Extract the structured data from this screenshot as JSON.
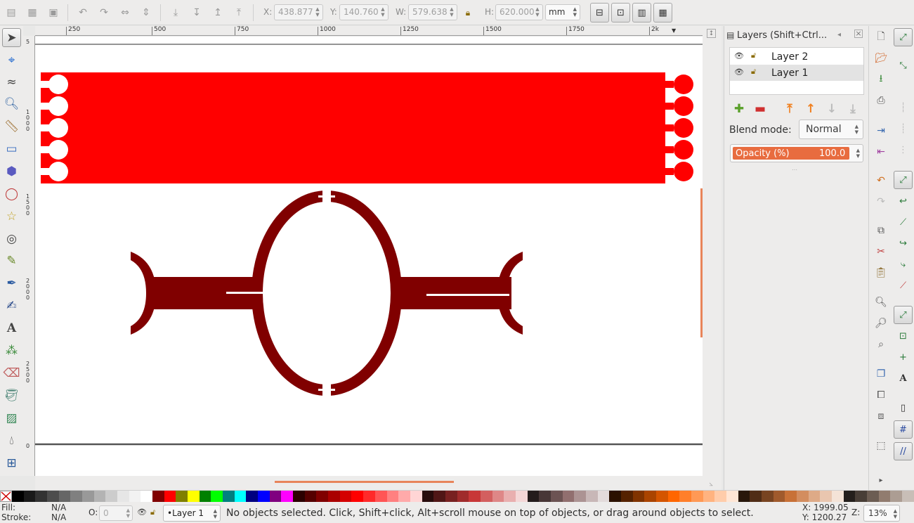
{
  "toolbar": {
    "x_label": "X:",
    "x_value": "438.877",
    "y_label": "Y:",
    "y_value": "140.760",
    "w_label": "W:",
    "w_value": "579.638",
    "h_label": "H:",
    "h_value": "620.000",
    "unit": "mm"
  },
  "ruler": {
    "top_labels": [
      "250",
      "500",
      "750",
      "1000",
      "1250",
      "1500",
      "1750",
      "2k"
    ],
    "left_labels": [
      "5",
      "1000",
      "1500",
      "2000",
      "2500",
      "0"
    ]
  },
  "layers_panel": {
    "title": "Layers (Shift+Ctrl...",
    "layers": [
      {
        "name": "Layer 2",
        "selected": false
      },
      {
        "name": "Layer 1",
        "selected": true
      }
    ],
    "blend_label": "Blend mode:",
    "blend_value": "Normal",
    "opacity_label": "Opacity (%)",
    "opacity_value": "100.0"
  },
  "status": {
    "fill_label": "Fill:",
    "fill_value": "N/A",
    "stroke_label": "Stroke:",
    "stroke_value": "N/A",
    "opacity_label": "O:",
    "opacity_value": "0",
    "current_layer": "•Layer 1",
    "message": "No objects selected. Click, Shift+click, Alt+scroll mouse on top of objects, or drag around objects to select.",
    "cursor_x": "X: 1999.05",
    "cursor_y": "Y: 1200.27",
    "zoom_label": "Z:",
    "zoom_value": "13%"
  },
  "colors": {
    "accent": "#e8845a",
    "red_shape": "#ff0000",
    "dark_red_shape": "#800000"
  },
  "palette": [
    "#000000",
    "#1a1a1a",
    "#333333",
    "#4d4d4d",
    "#666666",
    "#808080",
    "#999999",
    "#b3b3b3",
    "#cccccc",
    "#e6e6e6",
    "#f2f2f2",
    "#ffffff",
    "#800000",
    "#ff0000",
    "#808000",
    "#ffff00",
    "#008000",
    "#00ff00",
    "#008080",
    "#00ffff",
    "#000080",
    "#0000ff",
    "#800080",
    "#ff00ff",
    "#2b0000",
    "#550000",
    "#800000",
    "#aa0000",
    "#d40000",
    "#ff0000",
    "#ff2a2a",
    "#ff5555",
    "#ff8080",
    "#ffaaaa",
    "#ffd5d5",
    "#280b0b",
    "#501616",
    "#782121",
    "#a02c2c",
    "#c83737",
    "#d35f5f",
    "#de8787",
    "#e9afaf",
    "#f4d7d7",
    "#241c1c",
    "#483737",
    "#6c5353",
    "#916f6f",
    "#ac9393",
    "#c8b7b7",
    "#e3dbdb",
    "#2b1100",
    "#552200",
    "#803300",
    "#aa4400",
    "#d45500",
    "#ff6600",
    "#ff7f2a",
    "#ff9955",
    "#ffb380",
    "#ffccaa",
    "#ffe6d5",
    "#28170b",
    "#502d16",
    "#784421",
    "#a05a2c",
    "#c87137",
    "#d38d5f",
    "#deaa87",
    "#e9c6af",
    "#f4e3d7",
    "#241f1c",
    "#483e37",
    "#6c5d53",
    "#917c6f",
    "#ac9d93",
    "#c8beb7"
  ]
}
